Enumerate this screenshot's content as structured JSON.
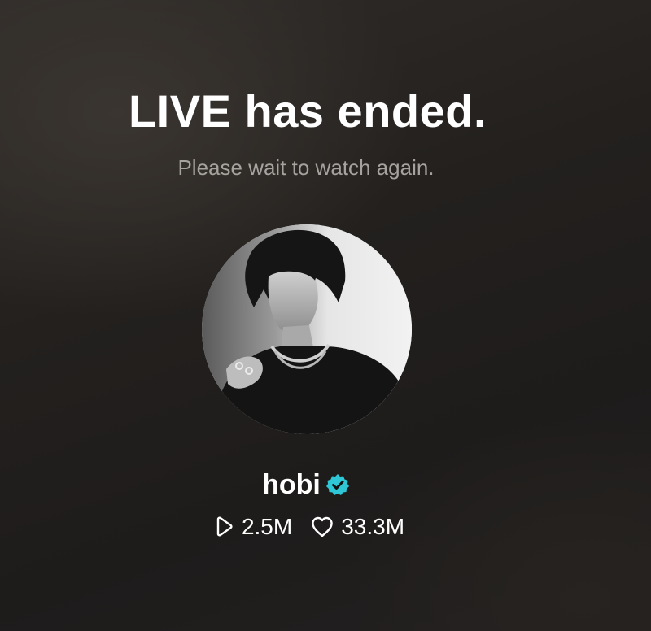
{
  "live_status": {
    "title": "LIVE has ended.",
    "subtitle": "Please wait to watch again."
  },
  "profile": {
    "name": "hobi",
    "verified": true,
    "avatar_icon": "profile-photo",
    "badge_color": "#2fc7d6"
  },
  "stats": {
    "plays": {
      "icon": "play-icon",
      "value": "2.5M"
    },
    "likes": {
      "icon": "heart-icon",
      "value": "33.3M"
    }
  }
}
